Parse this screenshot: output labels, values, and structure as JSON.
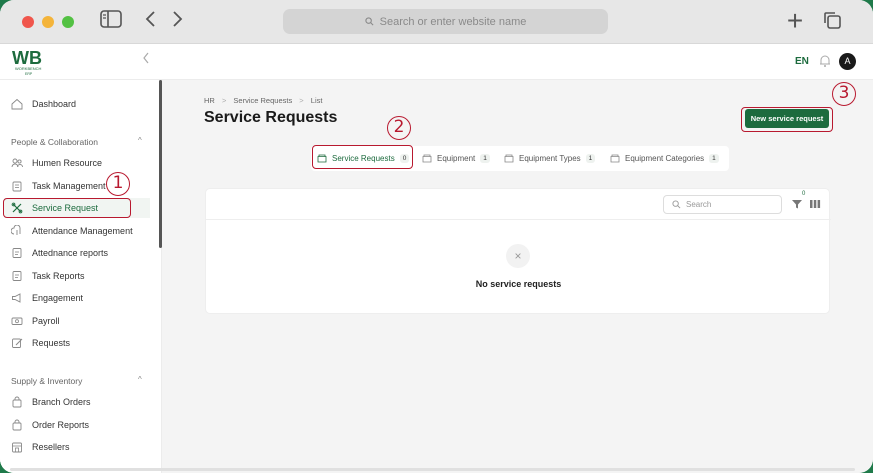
{
  "browser": {
    "url_placeholder": "Search or enter website name",
    "new_tab_symbol": "+"
  },
  "app": {
    "logo_text": "WB",
    "logo_sub": "WORKBENCH",
    "logo_sub2": "ERP",
    "language": "EN",
    "avatar_initial": "A",
    "accent": "#1d6b3e"
  },
  "sidebar": {
    "dashboard": "Dashboard",
    "section1": "People & Collaboration",
    "items1": [
      "Humen Resource",
      "Task Management",
      "Service Request",
      "Attendance Management",
      "Attednance reports",
      "Task Reports",
      "Engagement",
      "Payroll",
      "Requests"
    ],
    "section2": "Supply & Inventory",
    "items2": [
      "Branch Orders",
      "Order Reports",
      "Resellers"
    ]
  },
  "main": {
    "breadcrumb": [
      "HR",
      "Service Requests",
      "List"
    ],
    "title": "Service Requests",
    "new_button": "New service request",
    "tabs": [
      {
        "label": "Service Requests",
        "count": "0"
      },
      {
        "label": "Equipment",
        "count": "1"
      },
      {
        "label": "Equipment Types",
        "count": "1"
      },
      {
        "label": "Equipment Categories",
        "count": "1"
      }
    ],
    "search_placeholder": "Search",
    "filter_count": "0",
    "empty_text": "No service requests"
  },
  "annotations": [
    "1",
    "2",
    "3"
  ]
}
